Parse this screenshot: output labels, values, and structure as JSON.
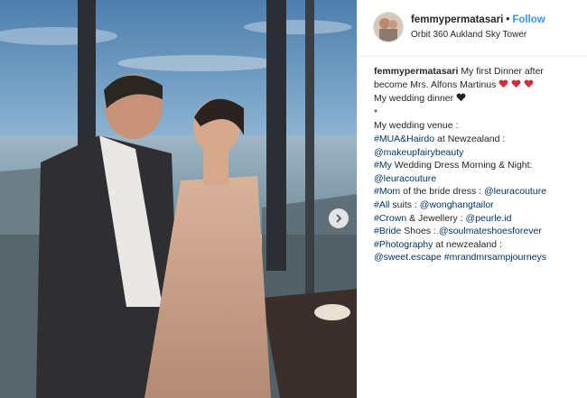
{
  "post": {
    "username": "femmypermatasari",
    "follow_label": "Follow",
    "location": "Orbit 360 Aukland Sky Tower"
  },
  "caption": {
    "username": "femmypermatasari",
    "intro": "My first Dinner after become Mrs. Alfons Martinus",
    "intro_line1": "My first Dinner after",
    "intro_line2": "become Mrs. Alfons Martinus",
    "wedding_dinner": "My wedding dinner",
    "separator": "*",
    "venue_label": "My wedding venue :",
    "lines": [
      [
        {
          "t": "#MUA&Hairdo",
          "link": true
        },
        {
          "t": " at Newzealand :",
          "link": false
        }
      ],
      [
        {
          "t": "@makeupfairybeauty",
          "link": true
        }
      ],
      [
        {
          "t": "#My",
          "link": true
        },
        {
          "t": " Wedding Dress Morning & Night:",
          "link": false
        }
      ],
      [
        {
          "t": "@leuracouture",
          "link": true
        }
      ],
      [
        {
          "t": "#Mom",
          "link": true
        },
        {
          "t": " of the bride dress : ",
          "link": false
        },
        {
          "t": "@leuracouture",
          "link": true
        }
      ],
      [
        {
          "t": "#All",
          "link": true
        },
        {
          "t": " suits : ",
          "link": false
        },
        {
          "t": "@wonghangtailor",
          "link": true
        }
      ],
      [
        {
          "t": "#Crown",
          "link": true
        },
        {
          "t": " & Jewellery : ",
          "link": false
        },
        {
          "t": "@peurle.id",
          "link": true
        }
      ],
      [
        {
          "t": "#Bride",
          "link": true
        },
        {
          "t": " Shoes : ",
          "link": false
        },
        {
          "t": "@soulmateshoesforever",
          "link": true
        }
      ],
      [
        {
          "t": "#Photography",
          "link": true
        },
        {
          "t": " at newzealand :",
          "link": false
        }
      ],
      [
        {
          "t": "@sweet.escape",
          "link": true
        },
        {
          "t": " ",
          "link": false
        },
        {
          "t": "#mrandmrsampjourneys",
          "link": true
        }
      ]
    ]
  },
  "colors": {
    "link": "#003569",
    "follow": "#3897f0",
    "text": "#262626",
    "heart_red": "#d62d3b",
    "heart_black": "#222222"
  },
  "icons": {
    "next": "chevron-right-icon",
    "heart_red": "red-heart-icon",
    "heart_black": "black-heart-icon"
  }
}
